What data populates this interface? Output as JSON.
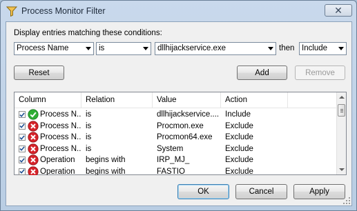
{
  "window": {
    "title": "Process Monitor Filter",
    "close_symbol": "✕"
  },
  "conditions": {
    "label": "Display entries matching these conditions:",
    "column_value": "Process Name",
    "relation_value": "is",
    "value_value": "dllhijackservice.exe",
    "then_label": "then",
    "action_value": "Include"
  },
  "buttons": {
    "reset": "Reset",
    "add": "Add",
    "remove": "Remove",
    "ok": "OK",
    "cancel": "Cancel",
    "apply": "Apply"
  },
  "list": {
    "headers": [
      "Column",
      "Relation",
      "Value",
      "Action"
    ],
    "rows": [
      {
        "checked": true,
        "status": "include",
        "column": "Process N...",
        "relation": "is",
        "value": "dllhijackservice....",
        "action": "Include"
      },
      {
        "checked": true,
        "status": "exclude",
        "column": "Process N...",
        "relation": "is",
        "value": "Procmon.exe",
        "action": "Exclude"
      },
      {
        "checked": true,
        "status": "exclude",
        "column": "Process N...",
        "relation": "is",
        "value": "Procmon64.exe",
        "action": "Exclude"
      },
      {
        "checked": true,
        "status": "exclude",
        "column": "Process N...",
        "relation": "is",
        "value": "System",
        "action": "Exclude"
      },
      {
        "checked": true,
        "status": "exclude",
        "column": "Operation",
        "relation": "begins with",
        "value": "IRP_MJ_",
        "action": "Exclude"
      },
      {
        "checked": true,
        "status": "exclude",
        "column": "Operation",
        "relation": "begins with",
        "value": "FASTIO",
        "action": "Exclude"
      }
    ]
  },
  "colors": {
    "include_icon": "#2eae34",
    "exclude_icon": "#d6232a",
    "accent_border": "#3c7fb1"
  }
}
